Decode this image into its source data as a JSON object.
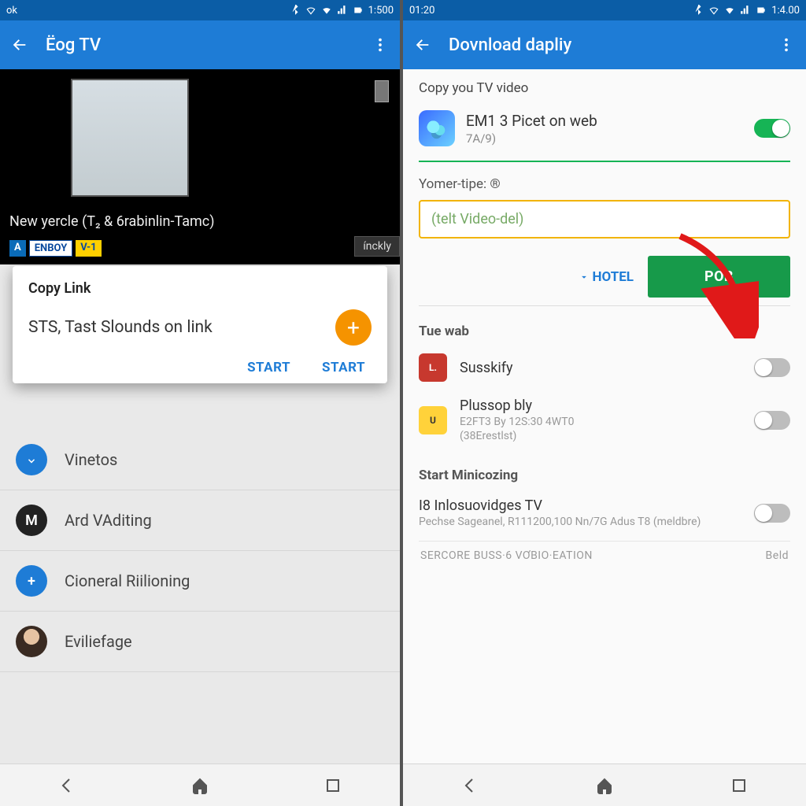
{
  "left": {
    "status": {
      "left": "ok",
      "time": "1:500"
    },
    "toolbar": {
      "title": "Ёog TV"
    },
    "video": {
      "caption": "New yercle (T₂ & 6rabinlin-Tamc)",
      "badge_a": "A",
      "badge_b": "ENBOY",
      "badge_c": "V-1",
      "chip": "ínckly"
    },
    "dialog": {
      "title": "Copy Link",
      "body": "STS, Tast Slounds on link",
      "action1": "START",
      "action2": "START"
    },
    "list": [
      {
        "label": "Vinetos"
      },
      {
        "label": "Ard VAditing"
      },
      {
        "label": "Cioneral Riilioning"
      },
      {
        "label": "Eviliefage"
      }
    ]
  },
  "right": {
    "status": {
      "left": "01:20",
      "time": "1:4.00"
    },
    "toolbar": {
      "title": "Dovnload dapliy"
    },
    "copy_section": {
      "heading": "Copy you TV video",
      "app_name": "EM1 3 Picet on web",
      "app_sub": "7A/9)"
    },
    "field": {
      "label": "Yomer-tipe: ®",
      "value": "(telt Video-del)"
    },
    "buttons": {
      "secondary": "HOTEL",
      "primary": "POB"
    },
    "section_web": {
      "title": "Tue wab",
      "items": [
        {
          "name": "Susskify"
        },
        {
          "name": "Plussop bly",
          "sub1": "E2FT3 By 12S:30 4WT0",
          "sub2": "(38Erestlst)"
        }
      ]
    },
    "section_start": {
      "title": "Start Minicozing",
      "item_name": "I8 Inlosuovidges TV",
      "item_sub": "Pechse Sageanel, R111200,100 Nn/7G Adus T8 (meldbre)"
    },
    "footer": {
      "left": "SERCORE BUSS·6 VƠBIO·EATION",
      "right": "Beld"
    }
  }
}
